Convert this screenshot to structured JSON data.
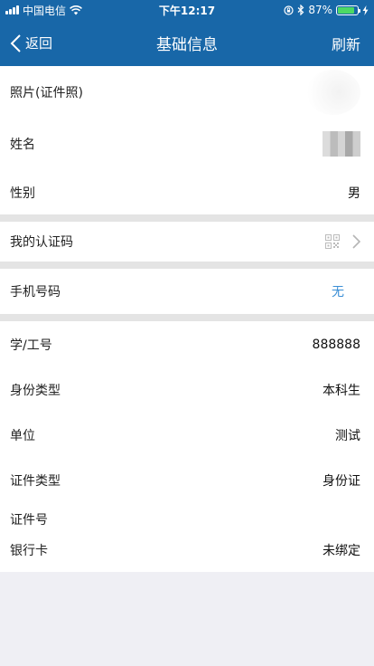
{
  "status_bar": {
    "carrier": "中国电信",
    "time": "下午12:17",
    "battery_percent": "87%",
    "battery_level": 0.87,
    "battery_color": "#4cd964"
  },
  "nav": {
    "back_label": "返回",
    "title": "基础信息",
    "refresh_label": "刷新",
    "bar_color": "#1867a8"
  },
  "rows": {
    "photo": {
      "label": "照片(证件照)"
    },
    "name": {
      "label": "姓名"
    },
    "gender": {
      "label": "性别",
      "value": "男"
    },
    "auth_code": {
      "label": "我的认证码"
    },
    "phone": {
      "label": "手机号码",
      "value": "无"
    },
    "student_id": {
      "label": "学/工号",
      "value": "888888"
    },
    "id_type": {
      "label": "身份类型",
      "value": "本科生"
    },
    "unit": {
      "label": "单位",
      "value": "测试"
    },
    "cert_type": {
      "label": "证件类型",
      "value": "身份证"
    },
    "cert_no": {
      "label": "证件号"
    },
    "bank_card": {
      "label": "银行卡",
      "value": "未绑定"
    }
  },
  "icons": [
    "signal-icon",
    "wifi-icon",
    "lock-rotation-icon",
    "bluetooth-icon",
    "battery-icon",
    "charging-icon",
    "back-chevron-icon",
    "qr-code-icon",
    "chevron-right-icon"
  ]
}
